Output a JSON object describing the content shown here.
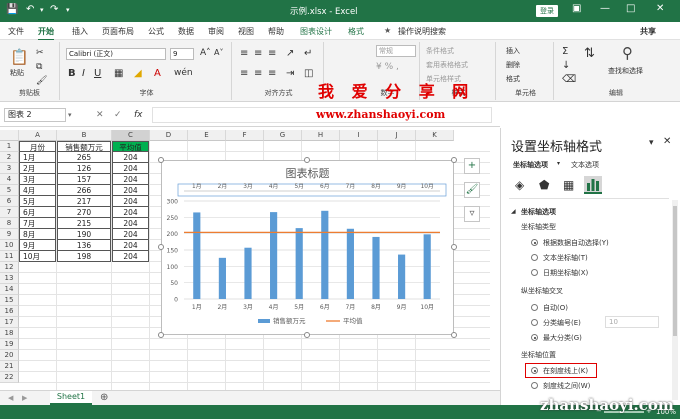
{
  "window": {
    "title": "示例.xlsx  -  Excel",
    "login": "登录"
  },
  "tabs": [
    "文件",
    "开始",
    "插入",
    "页面布局",
    "公式",
    "数据",
    "审阅",
    "视图",
    "帮助",
    "图表设计",
    "格式"
  ],
  "tell_me": "操作说明搜索",
  "share": "共享",
  "ribbon": {
    "paste": "粘贴",
    "clipboard": "剪贴板",
    "font_name": "Calibri (正文)",
    "font_size": "9",
    "font_group": "字体",
    "align_group": "对齐方式",
    "number_format": "常规",
    "number_group": "数字",
    "cond_format": "条件格式",
    "table_format": "套用表格格式",
    "cell_style": "单元格样式",
    "styles_group": "样式",
    "insert": "插入",
    "delete": "删除",
    "format": "格式",
    "cells_group": "单元格",
    "find_select": "查找和选择",
    "editing_group": "编辑"
  },
  "formula_bar": {
    "name_box": "图表 2",
    "fx": "fx"
  },
  "watermark": {
    "line1": "我 爱 分 享 网",
    "line2": "www.zhanshaoyi.com",
    "line3": "zhanshaoyi.com"
  },
  "columns": [
    "A",
    "B",
    "C",
    "D",
    "E",
    "F",
    "G",
    "H",
    "I",
    "J",
    "K"
  ],
  "rows": [
    "1",
    "2",
    "3",
    "4",
    "5",
    "6",
    "7",
    "8",
    "9",
    "10",
    "11",
    "12",
    "13",
    "14",
    "15",
    "16",
    "17",
    "18",
    "19",
    "20",
    "21",
    "22"
  ],
  "table": {
    "headers": [
      "月份",
      "销售额万元",
      "平均值"
    ],
    "rows": [
      [
        "1月",
        "265",
        "204"
      ],
      [
        "2月",
        "126",
        "204"
      ],
      [
        "3月",
        "157",
        "204"
      ],
      [
        "4月",
        "266",
        "204"
      ],
      [
        "5月",
        "217",
        "204"
      ],
      [
        "6月",
        "270",
        "204"
      ],
      [
        "7月",
        "215",
        "204"
      ],
      [
        "8月",
        "190",
        "204"
      ],
      [
        "9月",
        "136",
        "204"
      ],
      [
        "10月",
        "198",
        "204"
      ]
    ]
  },
  "sheet_tab": "Sheet1",
  "zoom": "100%",
  "chart_data": {
    "type": "bar",
    "title": "图表标题",
    "categories": [
      "1月",
      "2月",
      "3月",
      "4月",
      "5月",
      "6月",
      "7月",
      "8月",
      "9月",
      "10月"
    ],
    "series": [
      {
        "name": "销售额万元",
        "type": "bar",
        "values": [
          265,
          126,
          157,
          266,
          217,
          270,
          215,
          190,
          136,
          198
        ],
        "color": "#5b9bd5"
      },
      {
        "name": "平均值",
        "type": "line",
        "values": [
          204,
          204,
          204,
          204,
          204,
          204,
          204,
          204,
          204,
          204
        ],
        "color": "#ed7d31"
      }
    ],
    "yticks": [
      "300",
      "250",
      "200",
      "150",
      "100",
      "50",
      "0"
    ],
    "ylim": [
      0,
      300
    ],
    "legend": "bottom",
    "grid": true,
    "top_axis_labels": true
  },
  "panel": {
    "title": "设置坐标轴格式",
    "tab1": "坐标轴选项",
    "tab2": "文本选项",
    "section": "坐标轴选项",
    "axis_type": "坐标轴类型",
    "opt_auto": "根据数据自动选择(Y)",
    "opt_text": "文本坐标轴(T)",
    "opt_date": "日期坐标轴(X)",
    "cross": "纵坐标轴交叉",
    "opt_cross_auto": "自动(O)",
    "opt_cross_num": "分类编号(E)",
    "cross_num_value": "10",
    "opt_cross_max": "最大分类(G)",
    "axis_pos": "坐标轴位置",
    "opt_on_tick": "在刻度线上(K)",
    "opt_between": "刻度线之间(W)"
  },
  "accent": "#217346"
}
